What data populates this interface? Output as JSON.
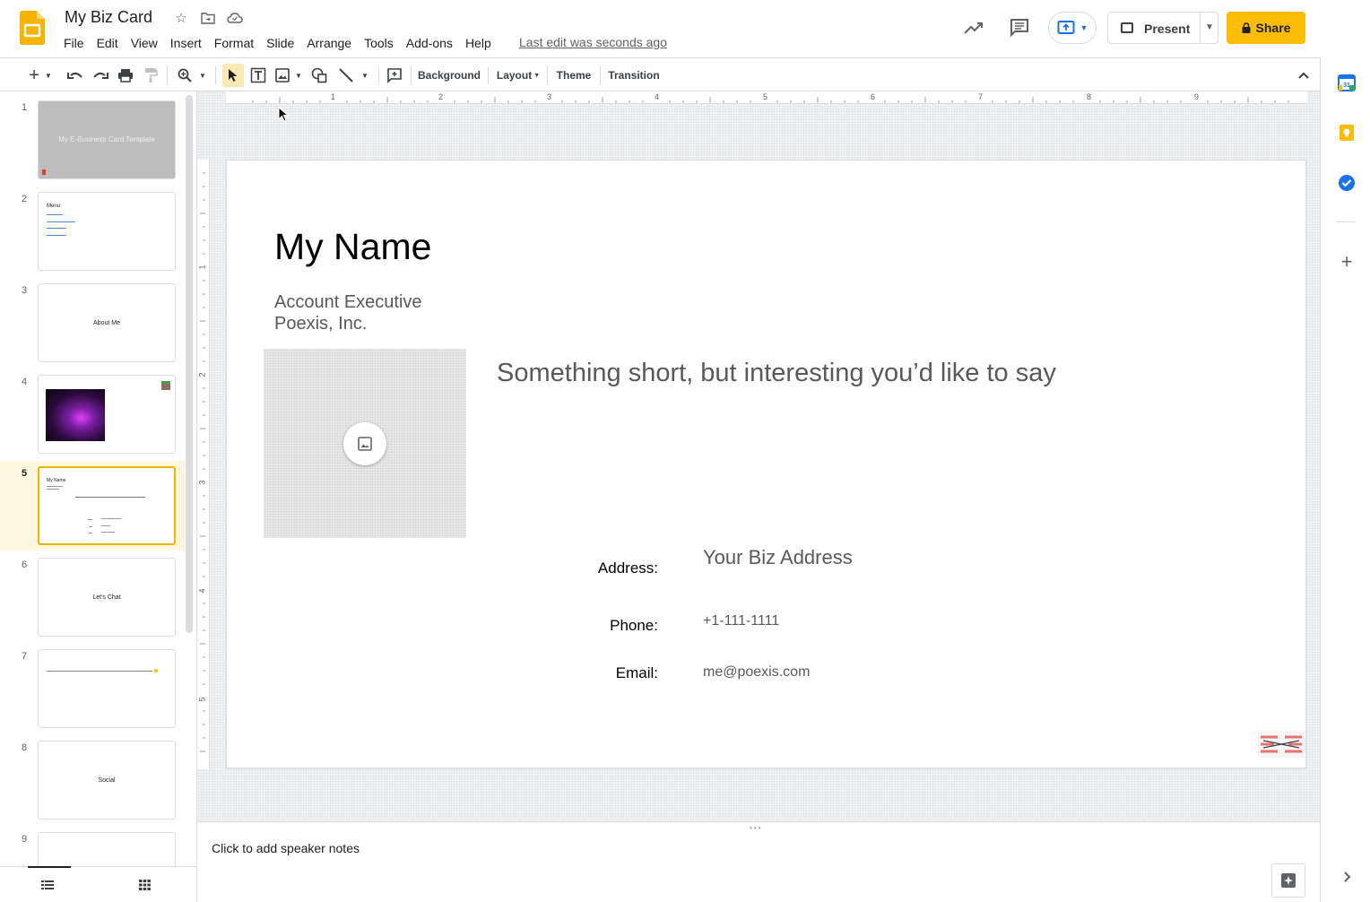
{
  "document": {
    "title": "My Biz Card",
    "last_edit": "Last edit was seconds ago"
  },
  "menu": [
    "File",
    "Edit",
    "View",
    "Insert",
    "Format",
    "Slide",
    "Arrange",
    "Tools",
    "Add-ons",
    "Help"
  ],
  "header_actions": {
    "present_label": "Present",
    "share_label": "Share"
  },
  "toolbar": {
    "background_label": "Background",
    "layout_label": "Layout",
    "theme_label": "Theme",
    "transition_label": "Transition"
  },
  "rulers": {
    "horizontal_labels": [
      "1",
      "2",
      "3",
      "4",
      "5",
      "6",
      "7",
      "8",
      "9"
    ],
    "vertical_labels": [
      "1",
      "2",
      "3",
      "4",
      "5"
    ]
  },
  "filmstrip": {
    "active_slide": 5,
    "slides": [
      {
        "number": "1",
        "text": "My E-Business Card Template"
      },
      {
        "number": "2",
        "text": "Menu"
      },
      {
        "number": "3",
        "text": "About Me"
      },
      {
        "number": "4",
        "text": ""
      },
      {
        "number": "5",
        "text": "My Name"
      },
      {
        "number": "6",
        "text": "Let's Chat"
      },
      {
        "number": "7",
        "text": ""
      },
      {
        "number": "8",
        "text": "Social"
      },
      {
        "number": "9",
        "text": ""
      }
    ]
  },
  "slide": {
    "name": "My Name",
    "role_line1": "Account Executive",
    "role_line2": "Poexis, Inc.",
    "tagline": "Something short, but interesting you’d like to say",
    "address_label": "Address:",
    "address_value": "Your Biz Address",
    "phone_label": "Phone:",
    "phone_value": "+1-111-1111",
    "email_label": "Email:",
    "email_value": "me@poexis.com"
  },
  "notes": {
    "placeholder": "Click to add speaker notes"
  },
  "colors": {
    "accent": "#fbbc04",
    "active_slide_bg": "#fef7e0",
    "active_slide_border": "#f4b400",
    "slide_text_gray": "#595959"
  }
}
